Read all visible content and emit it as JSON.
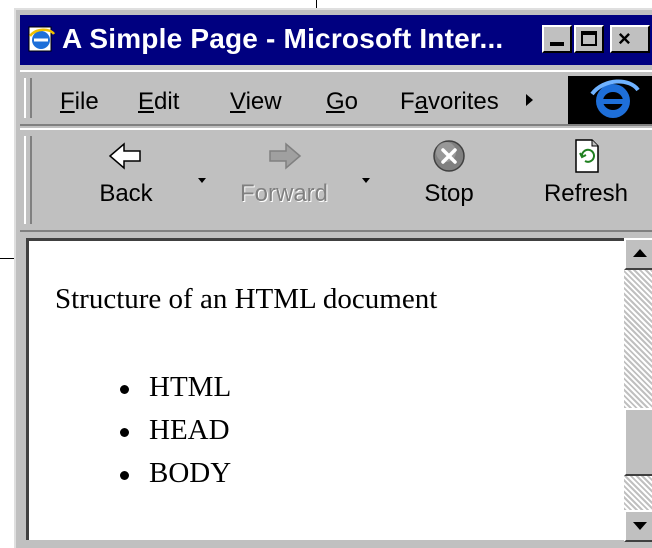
{
  "window": {
    "title": "A Simple Page - Microsoft Inter...",
    "title_icon": "ie-page-icon",
    "controls": {
      "minimize": "minimize-icon",
      "maximize": "maximize-icon",
      "close": "×"
    },
    "colors": {
      "titlebar": "#000080",
      "chrome": "#c0c0c0",
      "content": "#ffffff"
    }
  },
  "menubar": {
    "items": [
      {
        "label": "File",
        "accel": "F"
      },
      {
        "label": "Edit",
        "accel": "E"
      },
      {
        "label": "View",
        "accel": "V"
      },
      {
        "label": "Go",
        "accel": "G"
      },
      {
        "label": "Favorites",
        "accel": "a"
      }
    ],
    "more_icon": "chevron-right-icon",
    "logo_icon": "ie-logo-icon"
  },
  "toolbar": {
    "back": {
      "label": "Back",
      "icon": "back-arrow-icon"
    },
    "forward": {
      "label": "Forward",
      "icon": "forward-arrow-icon",
      "disabled": true
    },
    "stop": {
      "label": "Stop",
      "icon": "stop-icon"
    },
    "refresh": {
      "label": "Refresh",
      "icon": "refresh-icon"
    }
  },
  "content": {
    "paragraph": "Structure of an HTML document",
    "list": [
      "HTML",
      "HEAD",
      "BODY"
    ]
  },
  "scrollbar": {
    "up_icon": "scroll-up-icon",
    "down_icon": "scroll-down-icon"
  }
}
